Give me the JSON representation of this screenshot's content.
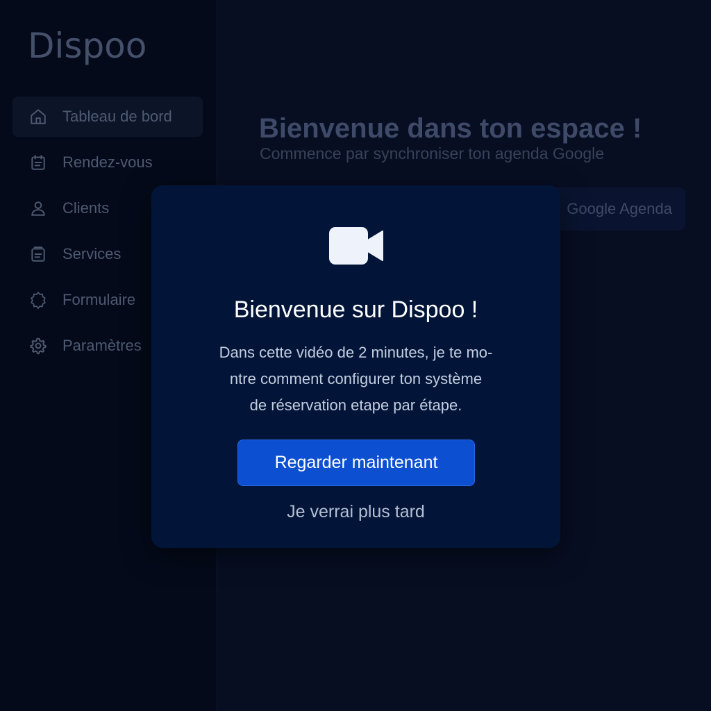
{
  "app": {
    "brand": "Dispoo"
  },
  "sidebar": {
    "items": [
      {
        "label": "Tableau de bord",
        "icon": "home-icon",
        "active": true
      },
      {
        "label": "Rendez-vous",
        "icon": "calendar-icon",
        "active": false
      },
      {
        "label": "Clients",
        "icon": "user-icon",
        "active": false
      },
      {
        "label": "Services",
        "icon": "services-icon",
        "active": false
      },
      {
        "label": "Formulaire",
        "icon": "badge-icon",
        "active": false
      },
      {
        "label": "Paramètres",
        "icon": "gear-icon",
        "active": false
      }
    ]
  },
  "main": {
    "title": "Bienvenue dans ton espace !",
    "subtitle": "Commence par synchroniser ton agenda Google",
    "sync_button_label": "Google Agenda"
  },
  "modal": {
    "icon": "video-camera-icon",
    "title": "Bienvenue sur Dispoo !",
    "description_lines": [
      "Dans cette vidéo de 2 minutes, je te mo-",
      "ntre comment configurer ton système",
      "de réservation etape par étape."
    ],
    "primary_button": "Regarder maintenant",
    "secondary_link": "Je verrai plus tard"
  },
  "colors": {
    "primary_button": "#0c4fd0",
    "modal_background": "#021538",
    "page_background": "#070e22"
  }
}
